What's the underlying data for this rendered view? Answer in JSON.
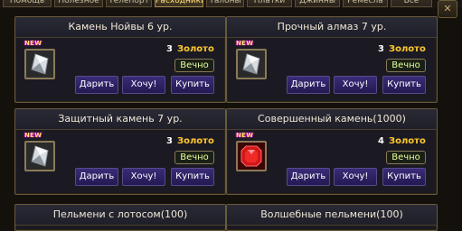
{
  "tabs": [
    "Помощь",
    "Полезное",
    "Телепорт",
    "Расходники",
    "Талоны",
    "Платки",
    "Джинны",
    "Ремесла",
    "Все"
  ],
  "active_tab": "Расходники",
  "buttons": {
    "gift": "Дарить",
    "want": "Хочу!",
    "buy": "Купить"
  },
  "new_badge": "NEW",
  "items": [
    {
      "name": "Камень Нойвы 6 ур.",
      "price": "3",
      "currency": "Золото",
      "duration": "Вечно",
      "is_new": true,
      "icon": "silver-crystal-icon"
    },
    {
      "name": "Прочный алмаз 7 ур.",
      "price": "3",
      "currency": "Золото",
      "duration": "Вечно",
      "is_new": true,
      "icon": "silver-crystal-icon"
    },
    {
      "name": "Защитный камень 7 ур.",
      "price": "3",
      "currency": "Золото",
      "duration": "Вечно",
      "is_new": true,
      "icon": "silver-crystal-icon"
    },
    {
      "name": "Совершенный камень(1000)",
      "price": "4",
      "currency": "Золото",
      "duration": "Вечно",
      "is_new": true,
      "icon": "red-gem-icon"
    },
    {
      "name": "Пельмени с лотосом(100)"
    },
    {
      "name": "Волшебные пельмени(100)"
    }
  ]
}
